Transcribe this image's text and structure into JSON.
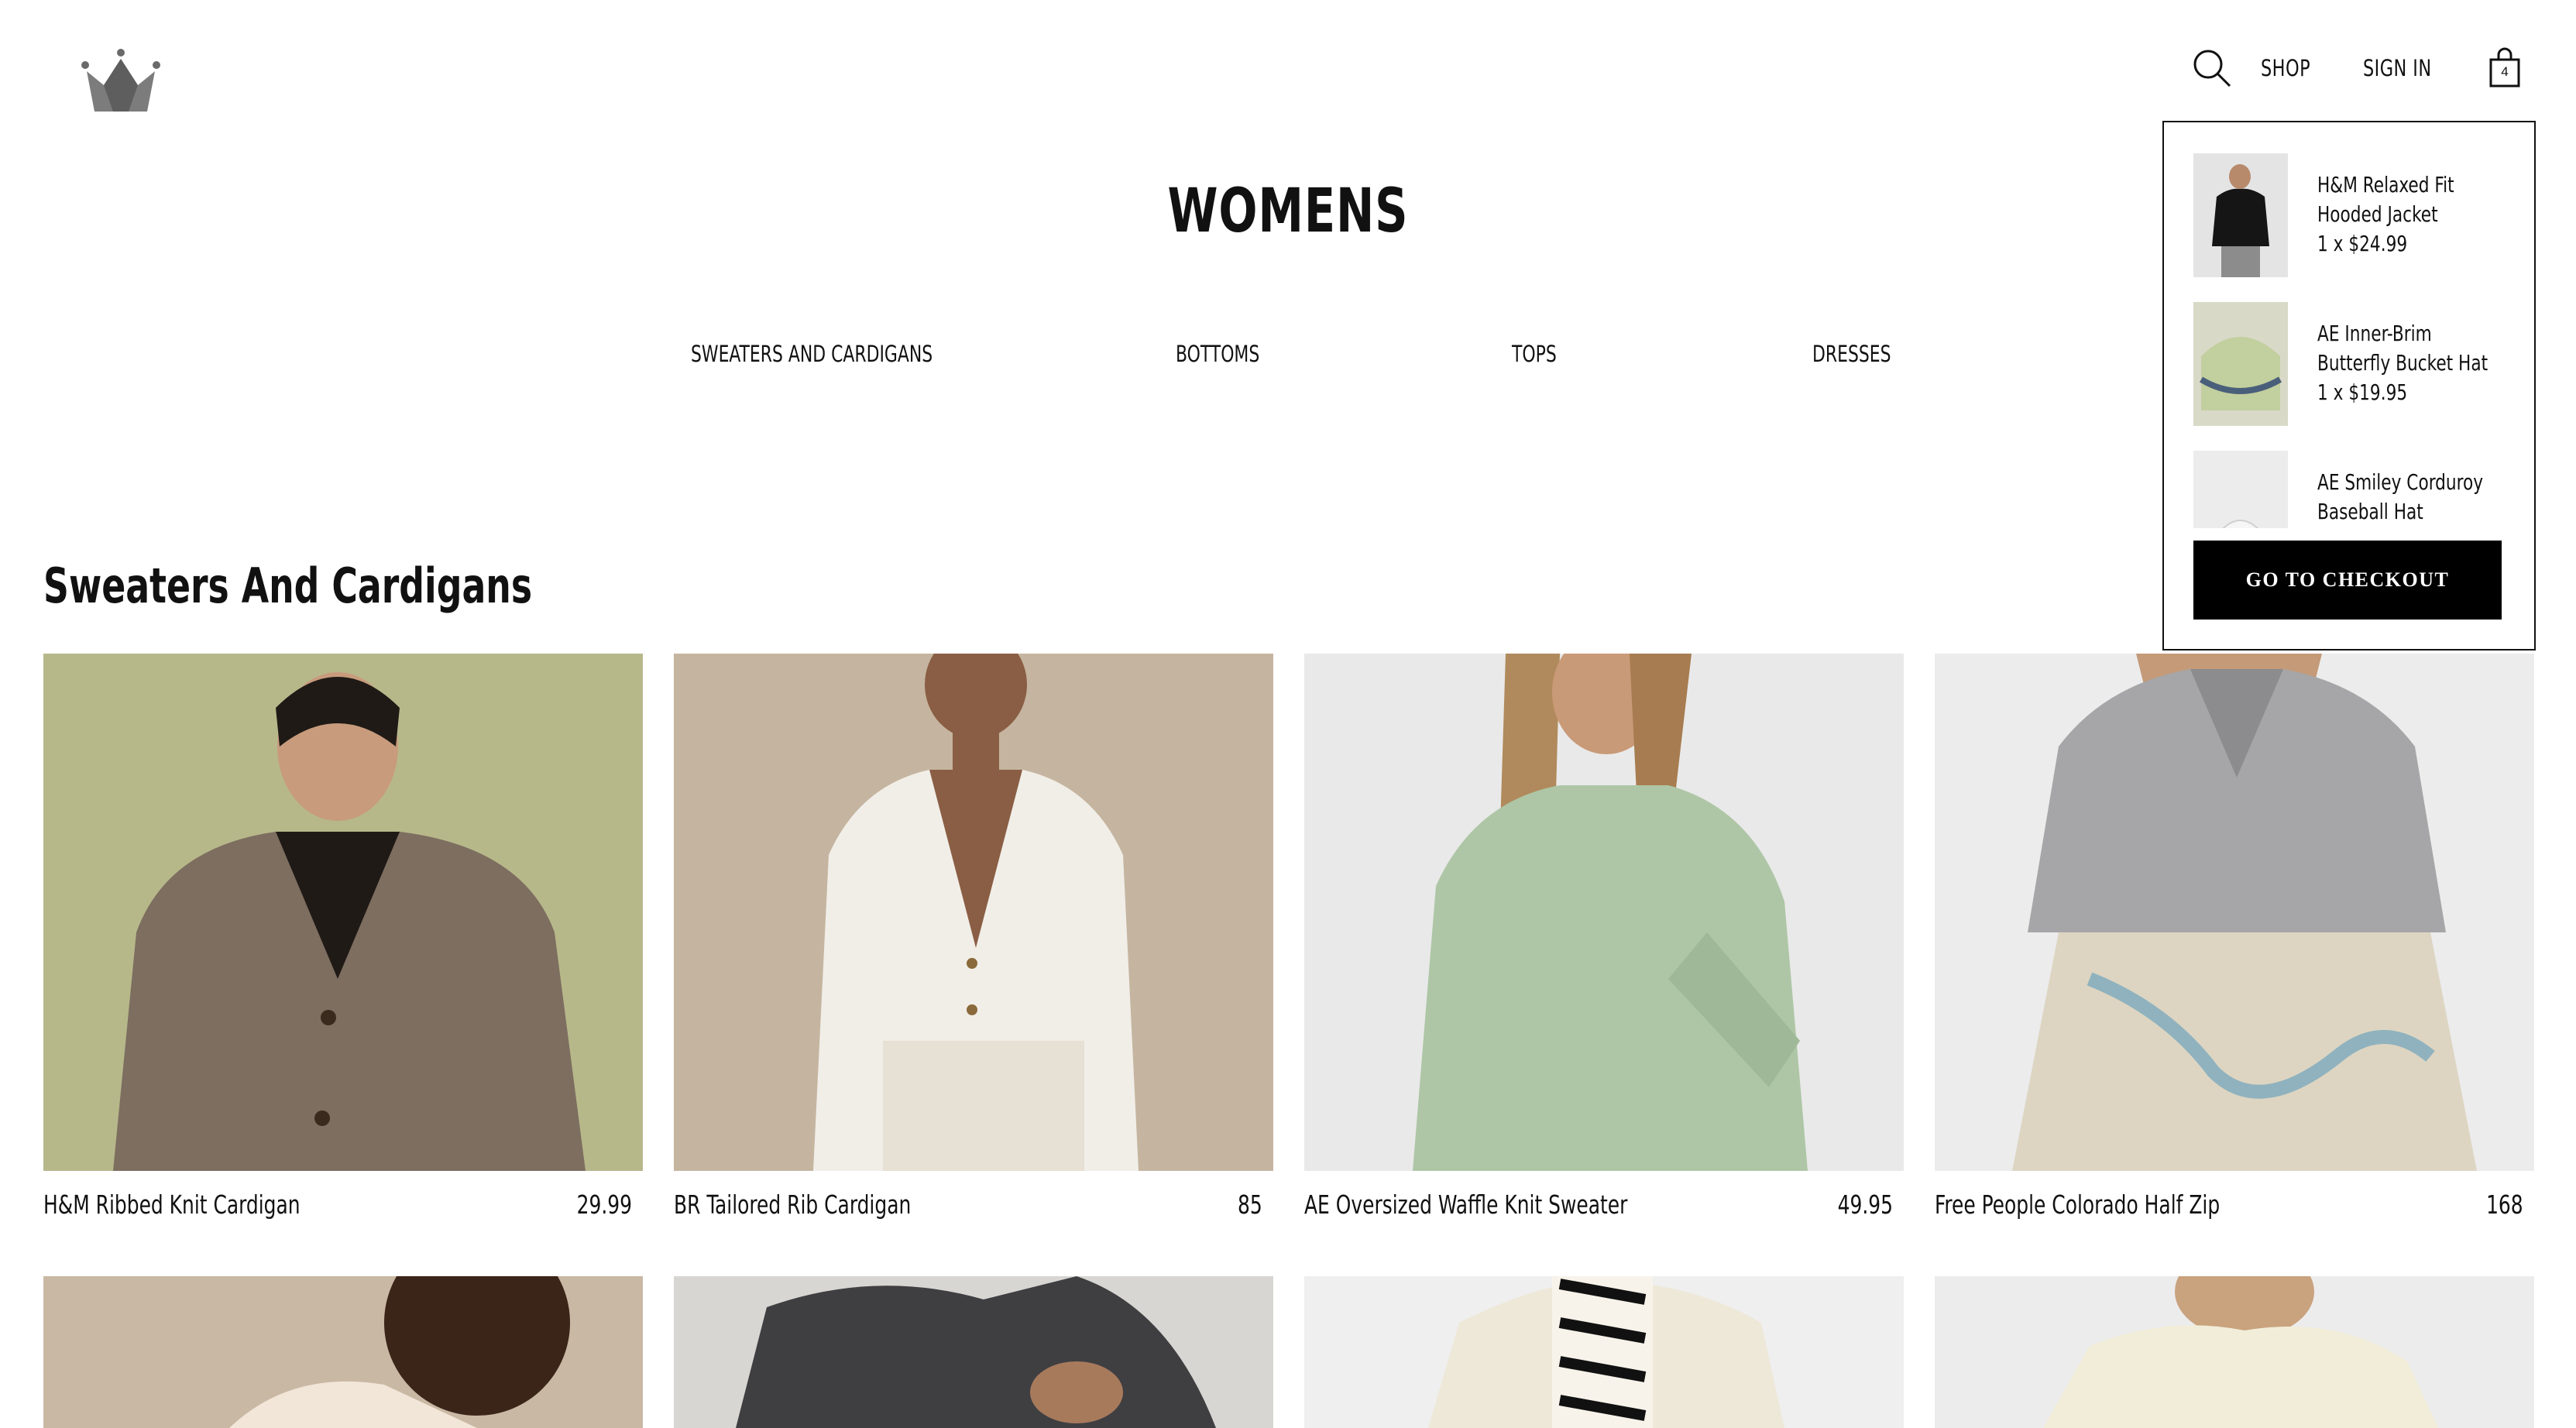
{
  "header": {
    "logo_icon": "crown-icon",
    "nav": {
      "search_icon": "search-icon",
      "shop_label": "SHOP",
      "sign_in_label": "SIGN IN",
      "cart_icon": "shopping-bag-icon",
      "cart_count": "4"
    }
  },
  "page": {
    "title": "WOMENS",
    "categories": [
      "SWEATERS AND CARDIGANS",
      "BOTTOMS",
      "TOPS",
      "DRESSES"
    ]
  },
  "section": {
    "title": "Sweaters And Cardigans"
  },
  "products": [
    {
      "name": "H&M Ribbed Knit Cardigan",
      "price": "29.99"
    },
    {
      "name": "BR Tailored Rib Cardigan",
      "price": "85"
    },
    {
      "name": "AE Oversized Waffle Knit Sweater",
      "price": "49.95"
    },
    {
      "name": "Free People Colorado Half Zip",
      "price": "168"
    }
  ],
  "cart": {
    "items": [
      {
        "name": "H&M Relaxed Fit Hooded Jacket",
        "qty_price": "1 x $24.99"
      },
      {
        "name": "AE Inner-Brim Butterfly Bucket Hat",
        "qty_price": "1 x $19.95"
      },
      {
        "name": "AE Smiley Corduroy Baseball Hat",
        "qty_price": ""
      }
    ],
    "checkout_label": "GO TO CHECKOUT"
  },
  "colors": {
    "accent": "#000000",
    "background": "#ffffff",
    "text": "#111111"
  }
}
